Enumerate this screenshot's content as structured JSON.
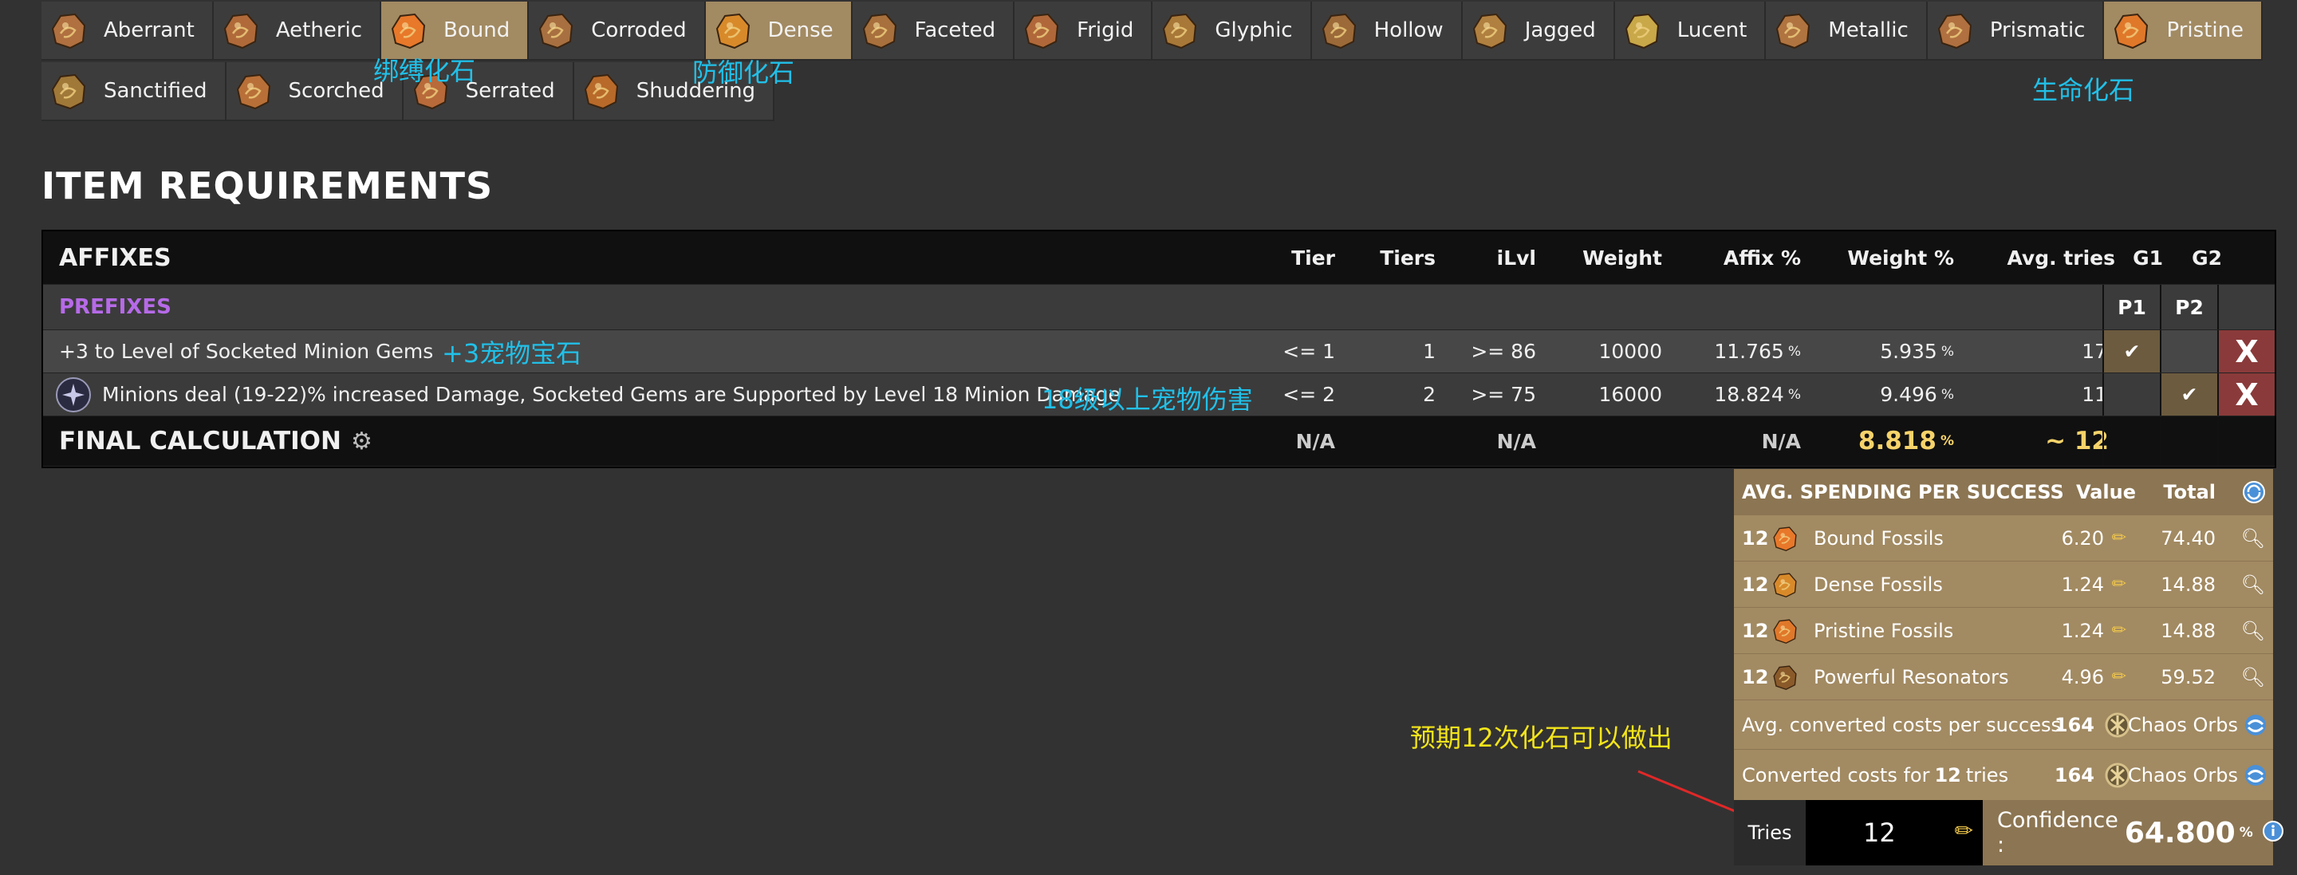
{
  "fossils": {
    "row1": [
      {
        "name": "Aberrant",
        "icon": "aberrant-fossil-icon",
        "selected": false
      },
      {
        "name": "Aetheric",
        "icon": "aetheric-fossil-icon",
        "selected": false
      },
      {
        "name": "Bound",
        "icon": "bound-fossil-icon",
        "selected": true
      },
      {
        "name": "Corroded",
        "icon": "corroded-fossil-icon",
        "selected": false
      },
      {
        "name": "Dense",
        "icon": "dense-fossil-icon",
        "selected": true
      },
      {
        "name": "Faceted",
        "icon": "faceted-fossil-icon",
        "selected": false
      },
      {
        "name": "Frigid",
        "icon": "frigid-fossil-icon",
        "selected": false
      },
      {
        "name": "Glyphic",
        "icon": "glyphic-fossil-icon",
        "selected": false
      },
      {
        "name": "Hollow",
        "icon": "hollow-fossil-icon",
        "selected": false
      },
      {
        "name": "Jagged",
        "icon": "jagged-fossil-icon",
        "selected": false
      },
      {
        "name": "Lucent",
        "icon": "lucent-fossil-icon",
        "selected": false
      },
      {
        "name": "Metallic",
        "icon": "metallic-fossil-icon",
        "selected": false
      },
      {
        "name": "Prismatic",
        "icon": "prismatic-fossil-icon",
        "selected": false
      },
      {
        "name": "Pristine",
        "icon": "pristine-fossil-icon",
        "selected": true
      }
    ],
    "row2": [
      {
        "name": "Sanctified",
        "icon": "sanctified-fossil-icon",
        "selected": false
      },
      {
        "name": "Scorched",
        "icon": "scorched-fossil-icon",
        "selected": false
      },
      {
        "name": "Serrated",
        "icon": "serrated-fossil-icon",
        "selected": false
      },
      {
        "name": "Shuddering",
        "icon": "shuddering-fossil-icon",
        "selected": false
      }
    ]
  },
  "annotations": {
    "bound": "绑缚化石",
    "dense": "防御化石",
    "pristine": "生命化石",
    "prefix1": "+3宠物宝石",
    "prefix2": "18级以上宠物伤害",
    "expect": "预期12次化石可以做出"
  },
  "section_title": "ITEM REQUIREMENTS",
  "table": {
    "headers": {
      "affixes": "AFFIXES",
      "tier": "Tier",
      "tiers": "Tiers",
      "ilvl": "iLvl",
      "weight": "Weight",
      "affix_pct": "Affix %",
      "weight_pct": "Weight %",
      "avg_tries": "Avg. tries",
      "g1": "G1",
      "g2": "G2"
    },
    "prefixes_label": "PREFIXES",
    "p1": "P1",
    "p2": "P2",
    "rows": [
      {
        "name": "+3 to Level of Socketed Minion Gems",
        "tier": "<= 1",
        "tiers": "1",
        "ilvl": ">= 86",
        "weight": "10000",
        "affix_pct": "11.765",
        "weight_pct": "5.935",
        "avg_tries": "17",
        "p1_checked": true,
        "p2_checked": false
      },
      {
        "name": "Minions deal (19-22)% increased Damage, Socketed Gems are Supported by Level 18 Minion Damage",
        "tier": "<= 2",
        "tiers": "2",
        "ilvl": ">= 75",
        "weight": "16000",
        "affix_pct": "18.824",
        "weight_pct": "9.496",
        "avg_tries": "11",
        "p1_checked": false,
        "p2_checked": true
      }
    ],
    "pct_unit": "%",
    "remove_label": "X",
    "final": {
      "label": "FINAL CALCULATION",
      "tier": "N/A",
      "ilvl": "N/A",
      "affix_pct": "N/A",
      "weight_pct": "8.818",
      "avg_tries": "~ 12"
    }
  },
  "spending": {
    "header": {
      "title": "AVG. SPENDING PER SUCCESS",
      "value": "Value",
      "total": "Total"
    },
    "items": [
      {
        "count": "12",
        "name": "Bound Fossils",
        "value": "6.20",
        "total": "74.40",
        "icon": "bound-fossil-icon"
      },
      {
        "count": "12",
        "name": "Dense Fossils",
        "value": "1.24",
        "total": "14.88",
        "icon": "dense-fossil-icon"
      },
      {
        "count": "12",
        "name": "Pristine Fossils",
        "value": "1.24",
        "total": "14.88",
        "icon": "pristine-fossil-icon"
      },
      {
        "count": "12",
        "name": "Powerful Resonators",
        "value": "4.96",
        "total": "59.52",
        "icon": "powerful-resonator-icon"
      }
    ],
    "converted_avg": {
      "label": "Avg. converted costs per success",
      "value": "164",
      "currency": "Chaos Orbs"
    },
    "converted_tries": {
      "label_pre": "Converted costs for ",
      "tries": "12",
      "label_post": " tries",
      "value": "164",
      "currency": "Chaos Orbs"
    },
    "tries_label": "Tries",
    "tries_value": "12",
    "confidence_label": "Confidence :",
    "confidence_value": "64.800",
    "confidence_unit": "%"
  }
}
